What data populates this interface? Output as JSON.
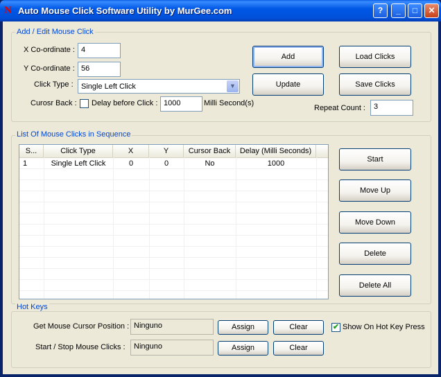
{
  "window": {
    "title": "Auto Mouse Click Software Utility by MurGee.com",
    "app_icon_glyph": "N",
    "buttons": {
      "help": "?",
      "minimize": "_",
      "maximize": "□",
      "close": "✕"
    }
  },
  "add_edit": {
    "group_title": "Add / Edit Mouse Click",
    "x_label": "X Co-ordinate :",
    "x_value": "4",
    "y_label": "Y Co-ordinate :",
    "y_value": "56",
    "click_type_label": "Click Type :",
    "click_type_value": "Single Left Click",
    "cursor_back_label": "Curosr Back :",
    "cursor_back_checked": false,
    "delay_label": "Delay before Click :",
    "delay_value": "1000",
    "delay_unit": "Milli Second(s)",
    "add_button": "Add",
    "update_button": "Update",
    "load_button": "Load Clicks",
    "save_button": "Save Clicks",
    "repeat_label": "Repeat Count :",
    "repeat_value": "3"
  },
  "list": {
    "group_title": "List Of Mouse Clicks in Sequence",
    "columns": [
      "S...",
      "Click Type",
      "X",
      "Y",
      "Cursor Back",
      "Delay (Milli Seconds)"
    ],
    "rows": [
      [
        "1",
        "Single Left Click",
        "0",
        "0",
        "No",
        "1000"
      ]
    ],
    "start_button": "Start",
    "move_up_button": "Move Up",
    "move_down_button": "Move Down",
    "delete_button": "Delete",
    "delete_all_button": "Delete All"
  },
  "hotkeys": {
    "group_title": "Hot Keys",
    "get_pos_label": "Get Mouse Cursor Position :",
    "get_pos_value": "Ninguno",
    "start_stop_label": "Start / Stop Mouse Clicks :",
    "start_stop_value": "Ninguno",
    "assign_label": "Assign",
    "clear_label": "Clear",
    "show_on_press_label": "Show On Hot Key Press",
    "show_on_press_checked": true
  },
  "colors": {
    "group_title": "#0046d5",
    "title_bar": "#0058e6",
    "face": "#ece9d8"
  }
}
